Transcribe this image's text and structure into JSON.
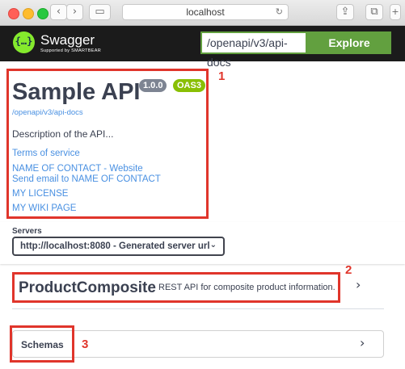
{
  "browser": {
    "address": "localhost",
    "back_glyph": "‹",
    "forward_glyph": "›",
    "reload_glyph": "↻",
    "share_glyph": "⇪",
    "tabs_glyph": "⧉",
    "sidebar_glyph": "▭"
  },
  "topbar": {
    "logo_glyph": "{…}",
    "brand": "Swagger",
    "brand_sub": "Supported by SMARTBEAR",
    "spec_url": "/openapi/v3/api-docs",
    "explore_label": "Explore",
    "accent_color": "#62a03f",
    "background_color": "#1b1b1b"
  },
  "info": {
    "title": "Sample API",
    "version": "1.0.0",
    "oas_badge": "OAS3",
    "spec_link": "/openapi/v3/api-docs",
    "description": "Description of the API...",
    "links": {
      "terms": "Terms of service",
      "contact_site": "NAME OF CONTACT - Website",
      "contact_email": "Send email to NAME OF CONTACT",
      "license": "MY LICENSE",
      "wiki": "MY WIKI PAGE"
    },
    "link_color": "#4990e2"
  },
  "servers": {
    "label": "Servers",
    "selected": "http://localhost:8080 - Generated server url",
    "chevron": "⌄"
  },
  "tag": {
    "name": "ProductComposite",
    "description": "REST API for composite product information.",
    "chevron": "›"
  },
  "schemas": {
    "label": "Schemas",
    "chevron": "›"
  },
  "annotations": {
    "one": "1",
    "two": "2",
    "three": "3",
    "color": "#e0352b"
  }
}
